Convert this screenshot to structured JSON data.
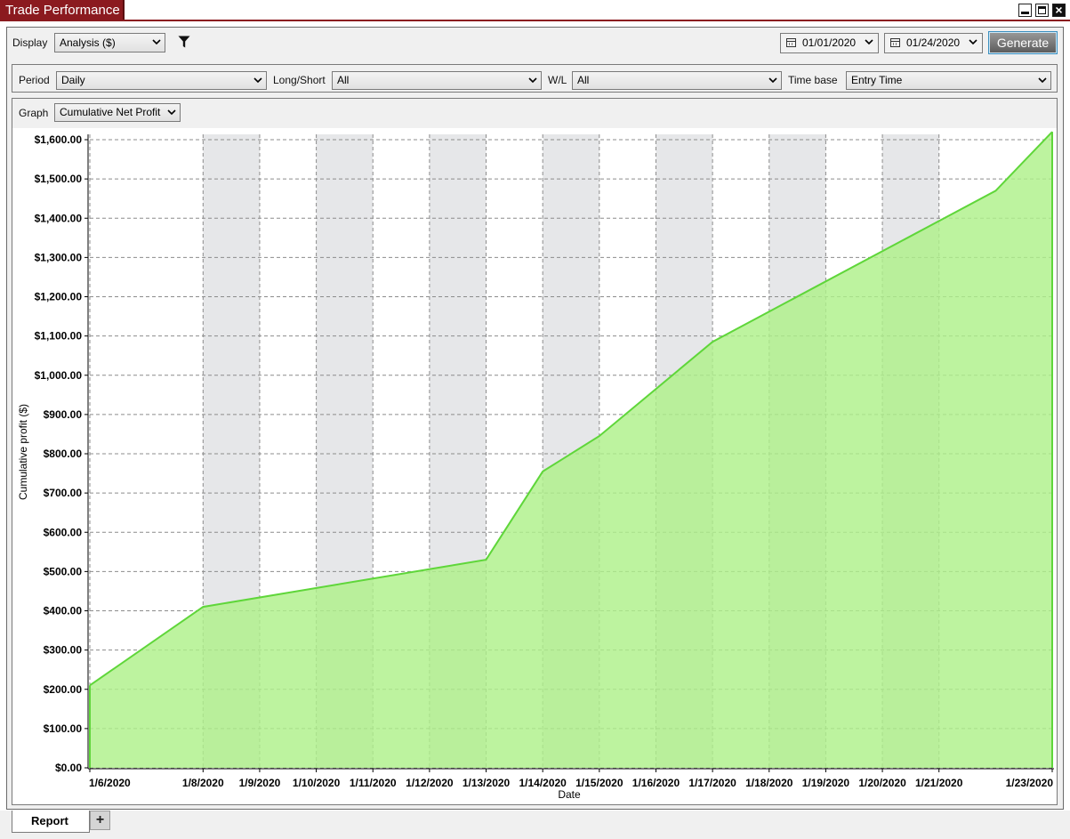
{
  "window": {
    "title": "Trade Performance",
    "close_glyph": "×"
  },
  "toolbar": {
    "display_label": "Display",
    "display_value": "Analysis ($)",
    "start_date": "01/01/2020",
    "end_date": "01/24/2020",
    "generate_label": "Generate"
  },
  "filters": {
    "period_label": "Period",
    "period_value": "Daily",
    "long_short_label": "Long/Short",
    "long_short_value": "All",
    "wl_label": "W/L",
    "wl_value": "All",
    "time_base_label": "Time base",
    "time_base_value": "Entry Time"
  },
  "graph": {
    "graph_label": "Graph",
    "graph_value": "Cumulative Net Profit"
  },
  "tabs": {
    "report_label": "Report",
    "add_label": "+"
  },
  "colors": {
    "title_bar": "#8b1a1f",
    "fill": "#aef08a",
    "line": "#5fd63a",
    "band": "#e6e7e9"
  },
  "chart_data": {
    "type": "area",
    "xlabel": "Date",
    "ylabel": "Cumulative profit ($)",
    "ylim": [
      0,
      1600
    ],
    "y_ticks": [
      0,
      100,
      200,
      300,
      400,
      500,
      600,
      700,
      800,
      900,
      1000,
      1100,
      1200,
      1300,
      1400,
      1500,
      1600
    ],
    "y_tick_labels": [
      "$0.00",
      "$100.00",
      "$200.00",
      "$300.00",
      "$400.00",
      "$500.00",
      "$600.00",
      "$700.00",
      "$800.00",
      "$900.00",
      "$1,000.00",
      "$1,100.00",
      "$1,200.00",
      "$1,300.00",
      "$1,400.00",
      "$1,500.00",
      "$1,600.00"
    ],
    "x_range": [
      "2020-01-06",
      "2020-01-23"
    ],
    "x_ticks": [
      "2020-01-06",
      "2020-01-08",
      "2020-01-09",
      "2020-01-10",
      "2020-01-11",
      "2020-01-12",
      "2020-01-13",
      "2020-01-14",
      "2020-01-15",
      "2020-01-16",
      "2020-01-17",
      "2020-01-18",
      "2020-01-19",
      "2020-01-20",
      "2020-01-21",
      "2020-01-23"
    ],
    "x_tick_labels": [
      "1/6/2020",
      "1/8/2020",
      "1/9/2020",
      "1/10/2020",
      "1/11/2020",
      "1/12/2020",
      "1/13/2020",
      "1/14/2020",
      "1/15/2020",
      "1/16/2020",
      "1/17/2020",
      "1/18/2020",
      "1/19/2020",
      "1/20/2020",
      "1/21/2020",
      "1/23/2020"
    ],
    "shaded_bands": [
      [
        "2020-01-08",
        "2020-01-09"
      ],
      [
        "2020-01-10",
        "2020-01-11"
      ],
      [
        "2020-01-12",
        "2020-01-13"
      ],
      [
        "2020-01-14",
        "2020-01-15"
      ],
      [
        "2020-01-16",
        "2020-01-17"
      ],
      [
        "2020-01-18",
        "2020-01-19"
      ],
      [
        "2020-01-20",
        "2020-01-21"
      ]
    ],
    "series": [
      {
        "x": [
          "2020-01-06",
          "2020-01-08",
          "2020-01-13",
          "2020-01-14",
          "2020-01-15",
          "2020-01-17",
          "2020-01-22",
          "2020-01-23"
        ],
        "y": [
          210,
          410,
          530,
          755,
          845,
          1085,
          1470,
          1620
        ]
      }
    ],
    "grid": true
  }
}
